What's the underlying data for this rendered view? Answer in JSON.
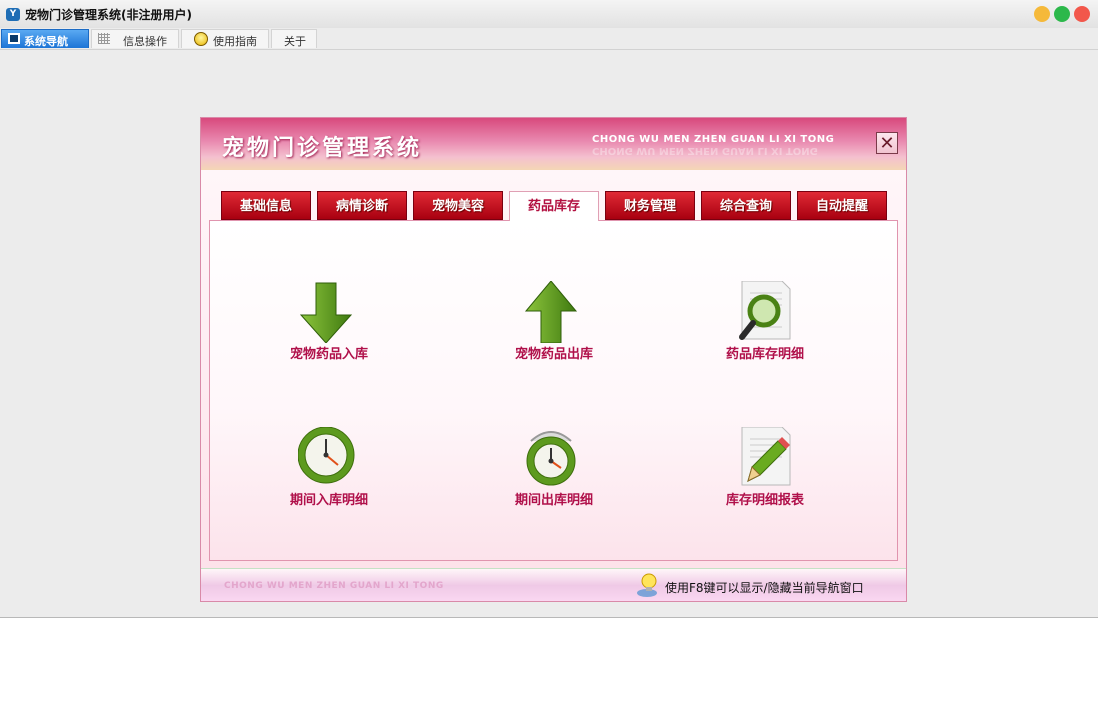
{
  "window": {
    "title": "宠物门诊管理系统(非注册用户)",
    "app_icon_text": "Y"
  },
  "menu_tabs": [
    {
      "label": "系统导航",
      "icon": "monitor-icon",
      "active": true
    },
    {
      "label": "信息操作",
      "icon": "grid-icon",
      "active": false
    },
    {
      "label": "使用指南",
      "icon": "bulb-icon",
      "active": false
    },
    {
      "label": "关于",
      "icon": "",
      "active": false
    }
  ],
  "panel": {
    "title": "宠物门诊管理系统",
    "subtitle": "CHONG WU MEN ZHEN GUAN LI XI TONG",
    "close_symbol": "✕",
    "tabs": [
      "基础信息",
      "病情诊断",
      "宠物美容",
      "药品库存",
      "财务管理",
      "综合查询",
      "自动提醒"
    ],
    "active_tab": "药品库存",
    "tiles": [
      {
        "label": "宠物药品入库",
        "icon": "down-arrow-icon"
      },
      {
        "label": "宠物药品出库",
        "icon": "up-arrow-icon"
      },
      {
        "label": "药品库存明细",
        "icon": "magnifier-document-icon"
      },
      {
        "label": "期间入库明细",
        "icon": "clock-icon"
      },
      {
        "label": "期间出库明细",
        "icon": "alarm-clock-icon"
      },
      {
        "label": "库存明细报表",
        "icon": "pencil-document-icon"
      }
    ],
    "footer_brand": "CHONG WU MEN ZHEN  GUAN LI XI TONG",
    "footer_hint": "使用F8键可以显示/隐藏当前导航窗口"
  },
  "colors": {
    "accent_red": "#c8101e",
    "label_crimson": "#b0104a",
    "icon_green": "#5a9a1a",
    "header_pink": "#d8497d"
  }
}
